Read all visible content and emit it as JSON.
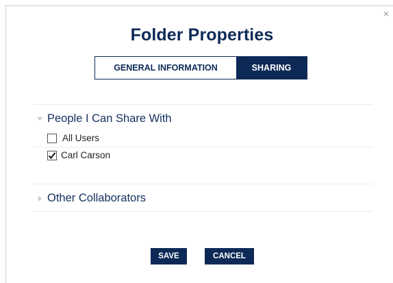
{
  "dialog": {
    "title": "Folder Properties",
    "close_icon": "close-icon",
    "close_glyph": "×"
  },
  "tabs": [
    {
      "label": "GENERAL INFORMATION",
      "active": false
    },
    {
      "label": "SHARING",
      "active": true
    }
  ],
  "sharing": {
    "sections": [
      {
        "title": "People I Can Share With",
        "expanded": true,
        "icon": "caret-down-icon",
        "items": [
          {
            "label": "All Users",
            "checked": false
          },
          {
            "label": "Carl Carson",
            "checked": true
          }
        ]
      },
      {
        "title": "Other Collaborators",
        "expanded": false,
        "icon": "caret-right-icon"
      }
    ]
  },
  "buttons": {
    "save_label": "SAVE",
    "cancel_label": "CANCEL"
  },
  "colors": {
    "primary": "#0d2a57",
    "caret": "#c8c8c8"
  }
}
